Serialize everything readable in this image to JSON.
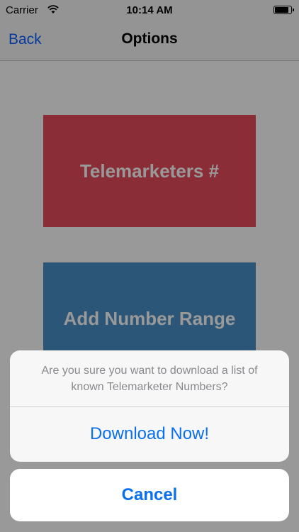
{
  "status_bar": {
    "carrier": "Carrier",
    "time": "10:14 AM",
    "icons": [
      "wifi-icon",
      "battery-icon"
    ]
  },
  "nav_bar": {
    "back_label": "Back",
    "title": "Options"
  },
  "main": {
    "buttons": [
      {
        "label": "Telemarketers #",
        "color": "#e74c5c"
      },
      {
        "label": "Add Number Range",
        "color": "#4a90c8"
      }
    ]
  },
  "action_sheet": {
    "message": "Are you sure you want to download a list of known Telemarketer Numbers?",
    "action_label": "Download Now!",
    "cancel_label": "Cancel",
    "accent_color": "#0a6ff0"
  }
}
